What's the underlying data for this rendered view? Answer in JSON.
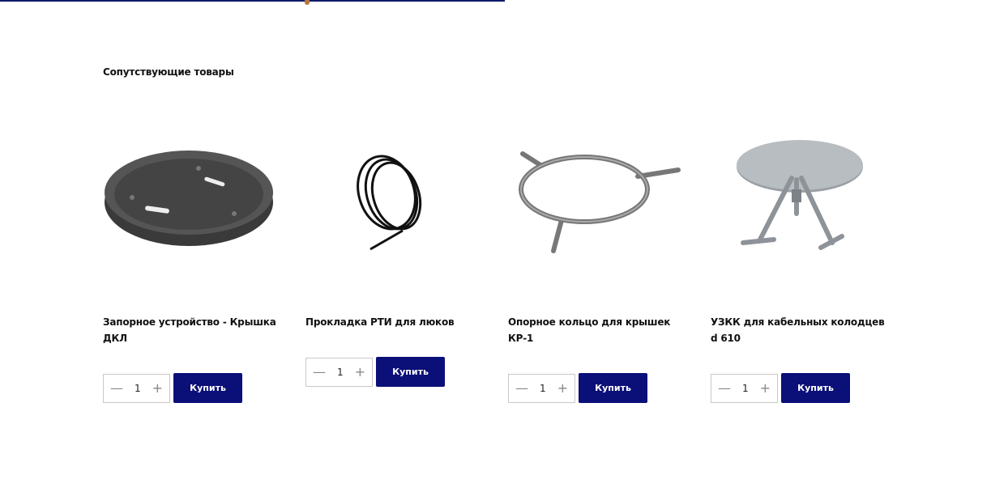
{
  "section_title": "Сопутствующие товары",
  "products": [
    {
      "name": "Запорное устройство - Крышка ДКЛ",
      "qty_minus": "—",
      "qty": "1",
      "qty_plus": "+",
      "buy_label": "Купить"
    },
    {
      "name": "Прокладка РТИ для люков",
      "qty_minus": "—",
      "qty": "1",
      "qty_plus": "+",
      "buy_label": "Купить"
    },
    {
      "name": "Опорное кольцо для крышек КР-1",
      "qty_minus": "—",
      "qty": "1",
      "qty_plus": "+",
      "buy_label": "Купить"
    },
    {
      "name": "УЗКК для кабельных колодцев d 610",
      "qty_minus": "—",
      "qty": "1",
      "qty_plus": "+",
      "buy_label": "Купить"
    }
  ],
  "colors": {
    "accent": "#0b0f78",
    "strip": "#0b1a6b"
  }
}
